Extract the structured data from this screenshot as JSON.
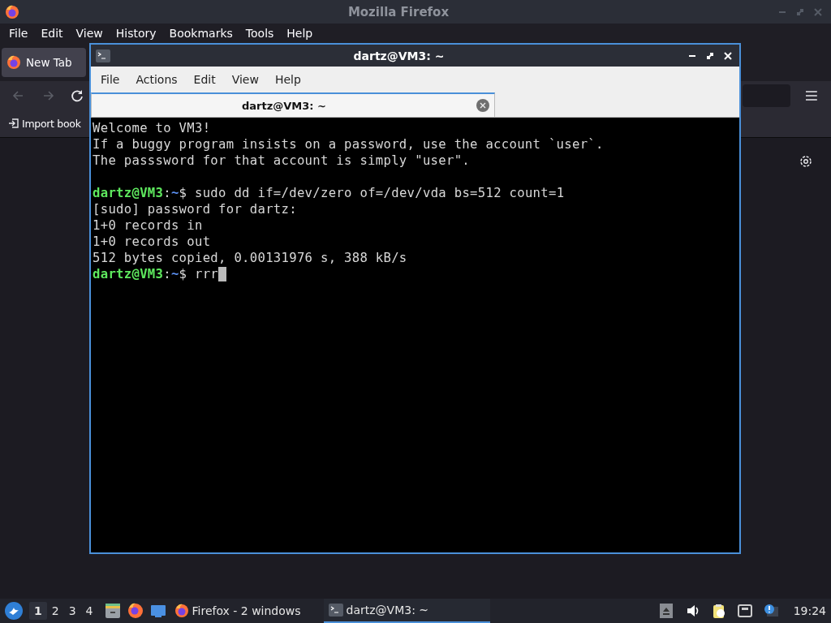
{
  "browser": {
    "title": "Mozilla Firefox",
    "menu": [
      "File",
      "Edit",
      "View",
      "History",
      "Bookmarks",
      "Tools",
      "Help"
    ],
    "tabs": [
      {
        "label": "New Tab",
        "selected": true
      }
    ],
    "nav": [
      {
        "kind": "back",
        "disabled": true
      },
      {
        "kind": "forward",
        "disabled": true
      },
      {
        "kind": "reload",
        "disabled": false
      }
    ],
    "bookmarks": [
      {
        "label": "Import book"
      }
    ]
  },
  "terminal": {
    "title": "dartz@VM3: ~",
    "menu": [
      "File",
      "Actions",
      "Edit",
      "View",
      "Help"
    ],
    "tabs": [
      {
        "label": "dartz@VM3: ~",
        "selected": true
      }
    ],
    "lines": [
      {
        "kind": "text",
        "segments": [
          {
            "kind": "output",
            "text": "Welcome to VM3!"
          }
        ]
      },
      {
        "kind": "text",
        "segments": [
          {
            "kind": "output",
            "text": "If a buggy program insists on a password, use the account `user`."
          }
        ]
      },
      {
        "kind": "text",
        "segments": [
          {
            "kind": "output",
            "text": "The passsword for that account is simply \"user\"."
          }
        ]
      },
      {
        "kind": "blank"
      },
      {
        "kind": "text",
        "segments": [
          {
            "kind": "user",
            "text": "dartz@VM3"
          },
          {
            "kind": "output",
            "text": ":"
          },
          {
            "kind": "path",
            "text": "~"
          },
          {
            "kind": "output",
            "text": "$ sudo dd if=/dev/zero of=/dev/vda bs=512 count=1"
          }
        ]
      },
      {
        "kind": "text",
        "segments": [
          {
            "kind": "output",
            "text": "[sudo] password for dartz:"
          }
        ]
      },
      {
        "kind": "text",
        "segments": [
          {
            "kind": "output",
            "text": "1+0 records in"
          }
        ]
      },
      {
        "kind": "text",
        "segments": [
          {
            "kind": "output",
            "text": "1+0 records out"
          }
        ]
      },
      {
        "kind": "text",
        "segments": [
          {
            "kind": "output",
            "text": "512 bytes copied, 0.00131976 s, 388 kB/s"
          }
        ]
      },
      {
        "kind": "text",
        "segments": [
          {
            "kind": "user",
            "text": "dartz@VM3"
          },
          {
            "kind": "output",
            "text": ":"
          },
          {
            "kind": "path",
            "text": "~"
          },
          {
            "kind": "output",
            "text": "$ rrr"
          }
        ],
        "cursor": true
      }
    ]
  },
  "taskbar": {
    "workspaces": [
      {
        "label": "1",
        "selected": true
      },
      {
        "label": "2",
        "selected": false
      },
      {
        "label": "3",
        "selected": false
      },
      {
        "label": "4",
        "selected": false
      }
    ],
    "launchers": [
      {
        "kind": "files"
      },
      {
        "kind": "firefox"
      },
      {
        "kind": "desktop"
      }
    ],
    "tasks": [
      {
        "kind": "firefox",
        "label": "Firefox - 2 windows",
        "selected": false
      },
      {
        "kind": "terminal",
        "label": "dartz@VM3: ~",
        "selected": true
      }
    ],
    "tray": [
      {
        "kind": "eject"
      },
      {
        "kind": "volume"
      },
      {
        "kind": "clipboard"
      },
      {
        "kind": "network"
      },
      {
        "kind": "notice"
      }
    ],
    "clock": "19:24"
  }
}
